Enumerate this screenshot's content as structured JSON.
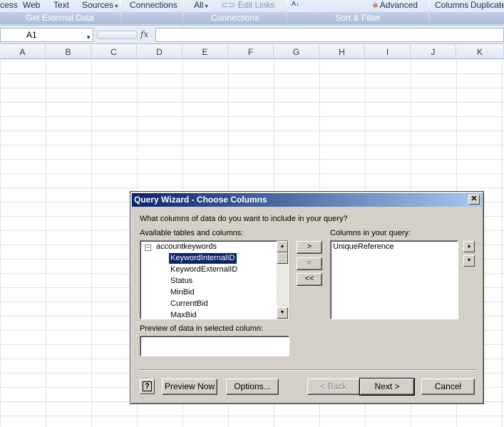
{
  "ribbon": {
    "get_external_data": {
      "items": [
        "cess",
        "Web",
        "Text",
        "Sources"
      ],
      "group_label": "Get External Data"
    },
    "connections": {
      "items": [
        "Connections"
      ],
      "group_label": ""
    },
    "connections2": {
      "items": [
        "All",
        "Edit Links"
      ],
      "group_label": "Connections"
    },
    "sort_filter": {
      "items": [
        "Advanced"
      ],
      "group_label": "Sort & Filter"
    },
    "data_tools": {
      "items": [
        "Columns",
        "Duplicates"
      ],
      "group_label": ""
    }
  },
  "formula_bar": {
    "name_box": "A1",
    "fx": "fx",
    "formula": ""
  },
  "columns": [
    "A",
    "B",
    "C",
    "D",
    "E",
    "F",
    "G",
    "H",
    "I",
    "J",
    "K"
  ],
  "dialog": {
    "title": "Query Wizard - Choose Columns",
    "close": "✕",
    "question": "What columns of data do you want to include in your query?",
    "available_label": "Available tables and columns:",
    "query_columns_label": "Columns in your query:",
    "tree": {
      "toggle": "−",
      "root": "accountkeywords",
      "items": [
        "KeywordInternalID",
        "KeywordExternalID",
        "Status",
        "MinBid",
        "CurrentBid",
        "MaxBid"
      ],
      "selected_index": 0
    },
    "query_columns": [
      "UniqueReference"
    ],
    "move_buttons": {
      "add": ">",
      "remove": "<",
      "remove_all": "<<"
    },
    "preview_label": "Preview of data in selected column:",
    "preview_value": "",
    "buttons": {
      "help": "?",
      "preview_now": "Preview Now",
      "options": "Options...",
      "back": "< Back",
      "next": "Next >",
      "cancel": "Cancel"
    }
  }
}
